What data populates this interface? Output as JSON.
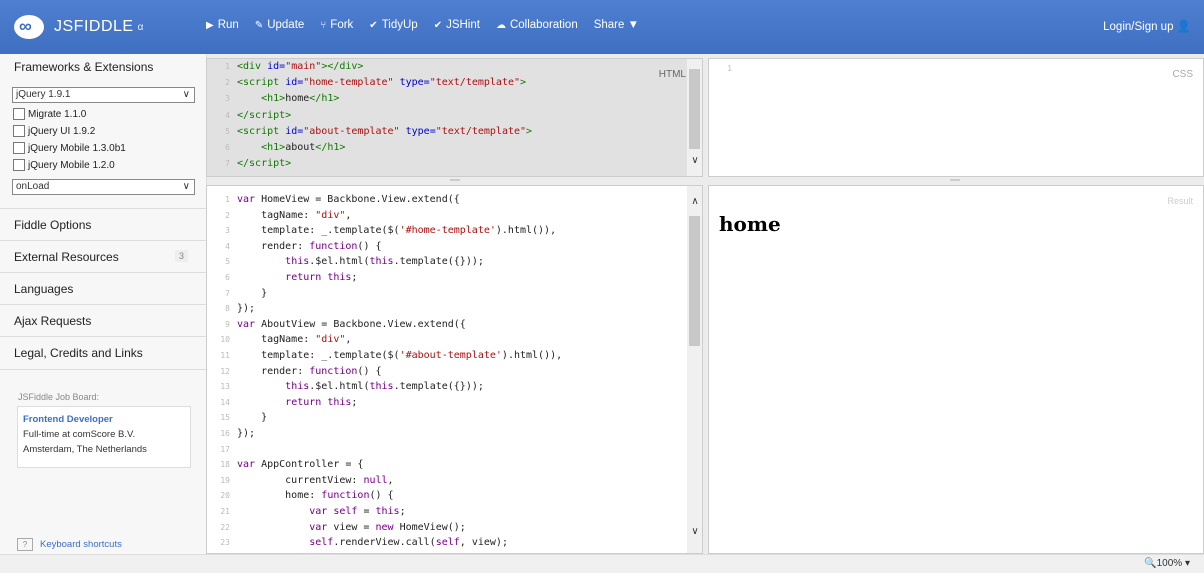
{
  "topbar": {
    "logo": "JSFIDDLE",
    "logo_sub": "α",
    "actions": [
      {
        "icon": "play-icon",
        "glyph": "▶",
        "label": "Run"
      },
      {
        "icon": "pencil-icon",
        "glyph": "✎",
        "label": "Update"
      },
      {
        "icon": "fork-icon",
        "glyph": "⑂",
        "label": "Fork"
      },
      {
        "icon": "check-icon",
        "glyph": "✔",
        "label": "TidyUp"
      },
      {
        "icon": "check-icon",
        "glyph": "✔",
        "label": "JSHint"
      },
      {
        "icon": "collab-icon",
        "glyph": "☁",
        "label": "Collaboration"
      },
      {
        "icon": "share-icon",
        "glyph": "",
        "label": "Share ▼"
      }
    ],
    "login": "Login/Sign up 👤"
  },
  "sidebar": {
    "title": "Frameworks & Extensions",
    "framework_select": "jQuery 1.9.1",
    "extensions": [
      "Migrate 1.1.0",
      "jQuery UI 1.9.2",
      "jQuery Mobile 1.3.0b1",
      "jQuery Mobile 1.2.0"
    ],
    "load_select": "onLoad",
    "sections": [
      {
        "label": "Fiddle Options"
      },
      {
        "label": "External Resources",
        "badge": "3"
      },
      {
        "label": "Languages"
      },
      {
        "label": "Ajax Requests"
      },
      {
        "label": "Legal, Credits and Links"
      }
    ],
    "job_board_title": "JSFiddle Job Board:",
    "job_link": "Frontend Developer",
    "job_line1": "Full-time at comScore B.V.",
    "job_line2": "Amsterdam, The Netherlands",
    "keyboard": "Keyboard shortcuts",
    "keyboard_icon": "?"
  },
  "panels": {
    "html_label": "HTML",
    "css_label": "CSS",
    "result_label": "Result",
    "result_heading": "home"
  },
  "html_code": [
    {
      "n": "1",
      "h": "<span class=\"tag\">&lt;div</span> <span class=\"attr\">id=</span><span class=\"str\">\"main\"</span><span class=\"tag\">&gt;&lt;/div&gt;</span>"
    },
    {
      "n": "2",
      "h": "<span class=\"tag\">&lt;script</span> <span class=\"attr\">id=</span><span class=\"str\">\"home-template\"</span> <span class=\"attr\">type=</span><span class=\"str\">\"text/template\"</span><span class=\"tag\">&gt;</span>"
    },
    {
      "n": "3",
      "h": "    <span class=\"tag\">&lt;h1&gt;</span>home<span class=\"tag\">&lt;/h1&gt;</span>"
    },
    {
      "n": "4",
      "h": "<span class=\"tag\">&lt;/script&gt;</span>"
    },
    {
      "n": "5",
      "h": "<span class=\"tag\">&lt;script</span> <span class=\"attr\">id=</span><span class=\"str\">\"about-template\"</span> <span class=\"attr\">type=</span><span class=\"str\">\"text/template\"</span><span class=\"tag\">&gt;</span>"
    },
    {
      "n": "6",
      "h": "    <span class=\"tag\">&lt;h1&gt;</span>about<span class=\"tag\">&lt;/h1&gt;</span>"
    },
    {
      "n": "7",
      "h": "<span class=\"tag\">&lt;/script&gt;</span>"
    }
  ],
  "js_code": [
    {
      "n": "1",
      "h": "<span class=\"kw\">var</span> HomeView = Backbone.View.extend({"
    },
    {
      "n": "2",
      "h": "    tagName: <span class=\"str\">\"div\"</span>,"
    },
    {
      "n": "3",
      "h": "    template: _.template($(<span class=\"str\">'#home-template'</span>).html()),"
    },
    {
      "n": "4",
      "h": "    render: <span class=\"kw\">function</span>() {"
    },
    {
      "n": "5",
      "h": "        <span class=\"kw\">this</span>.$el.html(<span class=\"kw\">this</span>.template({}));"
    },
    {
      "n": "6",
      "h": "        <span class=\"kw\">return this</span>;"
    },
    {
      "n": "7",
      "h": "    }"
    },
    {
      "n": "8",
      "h": "});"
    },
    {
      "n": "9",
      "h": "<span class=\"kw\">var</span> AboutView = Backbone.View.extend({"
    },
    {
      "n": "10",
      "h": "    tagName: <span class=\"str\">\"div\"</span>,"
    },
    {
      "n": "11",
      "h": "    template: _.template($(<span class=\"str\">'#about-template'</span>).html()),"
    },
    {
      "n": "12",
      "h": "    render: <span class=\"kw\">function</span>() {"
    },
    {
      "n": "13",
      "h": "        <span class=\"kw\">this</span>.$el.html(<span class=\"kw\">this</span>.template({}));"
    },
    {
      "n": "14",
      "h": "        <span class=\"kw\">return this</span>;"
    },
    {
      "n": "15",
      "h": "    }"
    },
    {
      "n": "16",
      "h": "});"
    },
    {
      "n": "17",
      "h": ""
    },
    {
      "n": "18",
      "h": "<span class=\"kw\">var</span> AppController = {"
    },
    {
      "n": "19",
      "h": "        currentView: <span class=\"kw\">null</span>,"
    },
    {
      "n": "20",
      "h": "        home: <span class=\"kw\">function</span>() {"
    },
    {
      "n": "21",
      "h": "            <span class=\"kw\">var self</span> = <span class=\"kw\">this</span>;"
    },
    {
      "n": "22",
      "h": "            <span class=\"kw\">var</span> view = <span class=\"kw\">new</span> HomeView();"
    },
    {
      "n": "23",
      "h": "            <span class=\"kw\">self</span>.renderView.call(<span class=\"kw\">self</span>, view);"
    }
  ],
  "statusbar": {
    "zoom": "🔍100%  ▾"
  },
  "colors": {
    "topbar": "#4477cc",
    "link": "#3f6fc0"
  }
}
